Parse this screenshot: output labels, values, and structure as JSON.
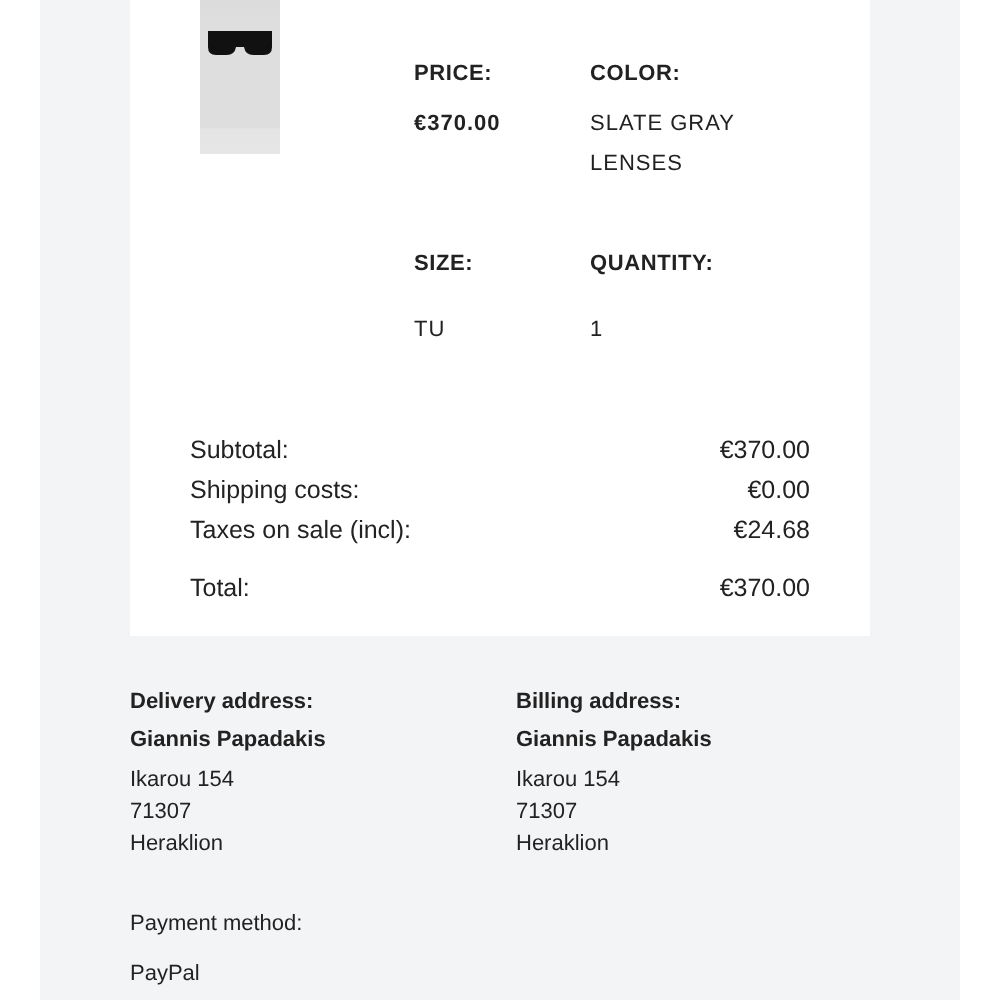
{
  "product": {
    "details": [
      {
        "label": "PRICE:",
        "value": "€370.00",
        "value_bold": true
      },
      {
        "label": "COLOR:",
        "value": "SLATE GRAY LENSES",
        "value_bold": false
      },
      {
        "label": "SIZE:",
        "value": "TU",
        "value_bold": false
      },
      {
        "label": "QUANTITY:",
        "value": "1",
        "value_bold": false
      }
    ]
  },
  "totals": [
    {
      "label": "Subtotal:",
      "value": "€370.00"
    },
    {
      "label": "Shipping costs:",
      "value": "€0.00"
    },
    {
      "label": "Taxes on sale (incl):",
      "value": "€24.68"
    }
  ],
  "total": {
    "label": "Total:",
    "value": "€370.00"
  },
  "addresses": [
    {
      "title": "Delivery address:",
      "name": "Giannis Papadakis",
      "lines": [
        "Ikarou 154",
        "71307",
        "Heraklion"
      ]
    },
    {
      "title": "Billing address:",
      "name": "Giannis Papadakis",
      "lines": [
        "Ikarou 154",
        "71307",
        "Heraklion"
      ]
    }
  ],
  "payment": {
    "label": "Payment method:",
    "value": "PayPal"
  }
}
